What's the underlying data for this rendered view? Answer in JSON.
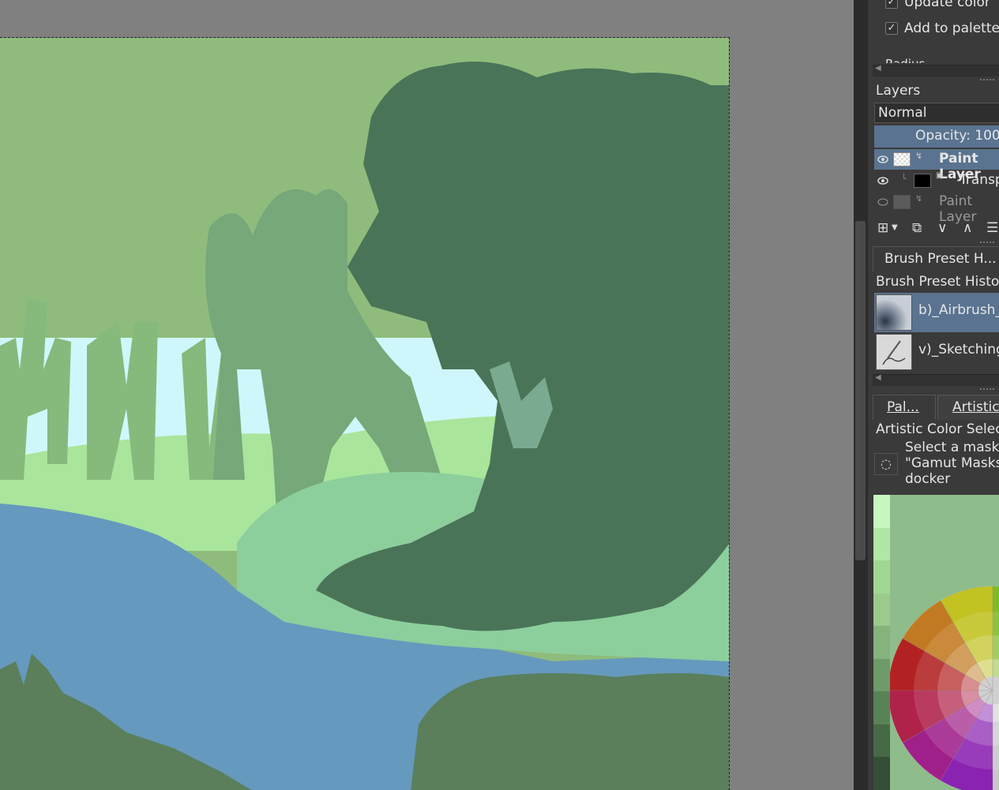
{
  "colors": {
    "selection": "#5a7390",
    "panel_bg": "#3a3a3a",
    "canvas_bg": "#808080",
    "sky": "#cff7fb",
    "water": "#6699be",
    "light_green": "#8fbc7c",
    "dark_tree": "#4a7457"
  },
  "color_options": {
    "update_color": {
      "label": "Update color",
      "checked": true
    },
    "add_to_palette": {
      "label": "Add to palette",
      "checked": true
    },
    "radius_label": "Radius"
  },
  "layers": {
    "title": "Layers",
    "blend_mode": "Normal",
    "opacity_text": "Opacity:  100",
    "items": [
      {
        "name": "Paint Layer",
        "visible": true,
        "selected": true
      },
      {
        "name": "Transparency",
        "visible": true,
        "selected": false
      },
      {
        "name": "Paint Layer",
        "visible": false,
        "selected": false
      }
    ],
    "toolbar_icons": [
      "add-layer-icon",
      "dropdown-icon",
      "duplicate-icon",
      "move-down-icon",
      "move-up-icon",
      "properties-icon"
    ]
  },
  "brush_history": {
    "tab_label": "Brush Preset H...",
    "title": "Brush Preset History",
    "items": [
      {
        "name": "b)_Airbrush_",
        "selected": true
      },
      {
        "name": "v)_Sketching",
        "selected": false
      }
    ]
  },
  "artistic": {
    "tabs": [
      "Pal...",
      "Artistic"
    ],
    "title": "Artistic Color Selector",
    "gamut_msg": [
      "Select a mask",
      "\"Gamut Masks\"",
      "docker"
    ],
    "ramp_colors": [
      "#c8f6c0",
      "#b1e6a6",
      "#a0d893",
      "#9bca8c",
      "#86b27d",
      "#6f9a69",
      "#5a8257",
      "#466946",
      "#354f36"
    ]
  }
}
